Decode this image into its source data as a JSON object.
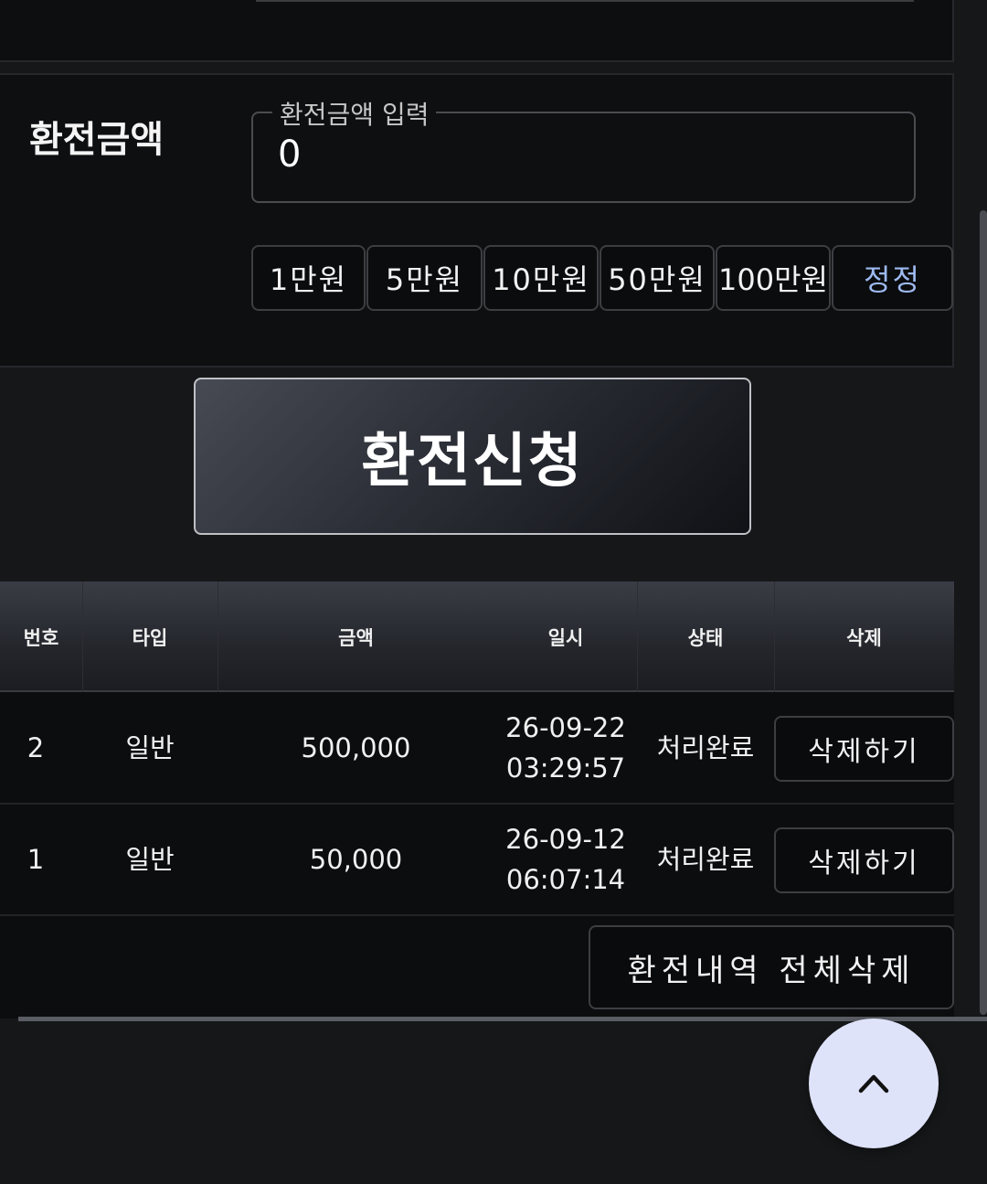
{
  "amount_section": {
    "label": "환전금액",
    "input_legend": "환전금액 입력",
    "input_value": "0"
  },
  "quick_amounts": [
    "1만원",
    "5만원",
    "10만원",
    "50만원",
    "100만원"
  ],
  "reset_label": "정정",
  "submit_label": "환전신청",
  "table": {
    "headers": [
      "번호",
      "타입",
      "금액",
      "일시",
      "상태",
      "삭제"
    ],
    "rows": [
      {
        "no": "2",
        "type": "일반",
        "amount": "500,000",
        "date": "26-09-22",
        "time": "03:29:57",
        "status": "처리완료",
        "delete": "삭제하기"
      },
      {
        "no": "1",
        "type": "일반",
        "amount": "50,000",
        "date": "26-09-12",
        "time": "06:07:14",
        "status": "처리완료",
        "delete": "삭제하기"
      }
    ]
  },
  "delete_all_label": "환전내역 전체삭제",
  "icons": {
    "scroll_top": "chevron-up-icon"
  },
  "colors": {
    "accent_reset": "#9dbaf0",
    "fab": "#dfe3fa",
    "background": "#0c0d0f"
  }
}
